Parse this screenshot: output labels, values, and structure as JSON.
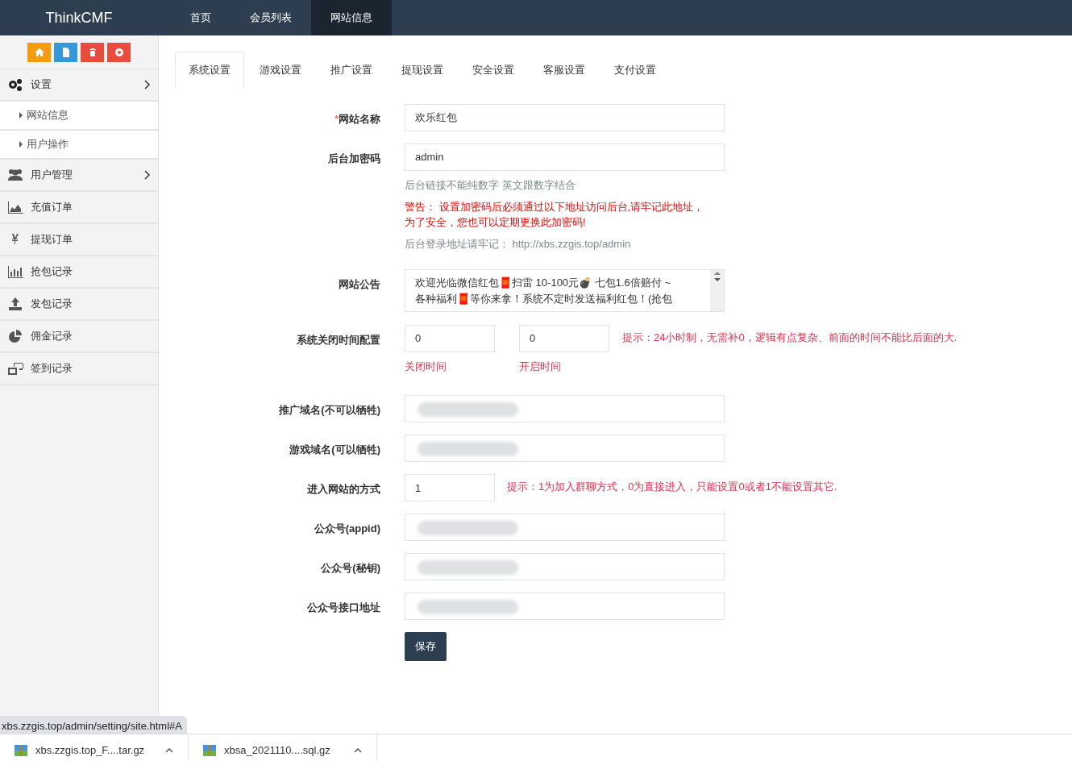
{
  "navbar": {
    "brand": "ThinkCMF",
    "items": [
      {
        "label": "首页",
        "selected": false
      },
      {
        "label": "会员列表",
        "selected": false
      },
      {
        "label": "网站信息",
        "selected": true
      }
    ]
  },
  "sidebar": {
    "toolbar": [
      {
        "color": "#f39c12"
      },
      {
        "color": "#3498db"
      },
      {
        "color": "#e74c3c"
      },
      {
        "color": "#e74c3c"
      }
    ],
    "items": [
      {
        "label": "设置",
        "kind": "group",
        "children": [
          {
            "label": "网站信息"
          },
          {
            "label": "用户操作"
          }
        ]
      },
      {
        "label": "用户管理",
        "kind": "group"
      },
      {
        "label": "充值订单",
        "kind": "link"
      },
      {
        "label": "提现订单",
        "kind": "link"
      },
      {
        "label": "抢包记录",
        "kind": "link"
      },
      {
        "label": "发包记录",
        "kind": "link"
      },
      {
        "label": "佣金记录",
        "kind": "link"
      },
      {
        "label": "签到记录",
        "kind": "link"
      }
    ]
  },
  "tabs": [
    {
      "label": "系统设置",
      "selected": true
    },
    {
      "label": "游戏设置",
      "selected": false
    },
    {
      "label": "推广设置",
      "selected": false
    },
    {
      "label": "提现设置",
      "selected": false
    },
    {
      "label": "安全设置",
      "selected": false
    },
    {
      "label": "客服设置",
      "selected": false
    },
    {
      "label": "支付设置",
      "selected": false
    }
  ],
  "fields": [
    {
      "kind": "text",
      "label": "网站名称",
      "required_mark": "*",
      "value": "欢乐红包"
    },
    {
      "kind": "text",
      "label": "后台加密码",
      "value": "admin",
      "notes": [
        {
          "text": "后台链接不能纯数字 英文跟数字结合",
          "kind": "muted"
        },
        {
          "text": "警告： 设置加密码后必须通过以下地址访问后台,请牢记此地址，为了安全，您也可以定期更换此加密码!",
          "kind": "danger"
        },
        {
          "text": "后台登录地址请牢记：  http://xbs.zzgis.top/admin",
          "kind": "muted"
        }
      ]
    },
    {
      "kind": "textarea",
      "label": "网站公告",
      "lines": [
        "欢迎光临微信红包🧧扫雷  10-100元💣 七包1.6倍赔付 ~",
        "各种福利🧧等你来拿！系统不定时发送福利红包！(抢包"
      ]
    },
    {
      "kind": "pair",
      "label": "系统关闭时间配置",
      "inputs": [
        {
          "value": "0",
          "caption": "关闭时间"
        },
        {
          "value": "0",
          "caption": "开启时间"
        }
      ],
      "hint": "提示：24小时制，无需补0，逻辑有点复杂、前面的时间不能比后面的大."
    },
    {
      "kind": "text",
      "label": "推广域名(不可以牺牲)",
      "redacted": true
    },
    {
      "kind": "text",
      "label": "游戏域名(可以牺牲)",
      "redacted": true
    },
    {
      "kind": "short",
      "label": "进入网站的方式",
      "value": "1",
      "hint": "提示：1为加入群聊方式，0为直接进入，只能设置0或者1不能设置其它."
    },
    {
      "kind": "text",
      "label": "公众号(appid)",
      "redacted": true
    },
    {
      "kind": "text",
      "label": "公众号(秘钥)",
      "redacted": true
    },
    {
      "kind": "text",
      "label": "公众号接口地址",
      "redacted": true
    }
  ],
  "save_button": "保存",
  "status_url": "xbs.zzgis.top/admin/setting/site.html#A",
  "downloads": [
    "xbs.zzgis.top_F....tar.gz",
    "xbsa_2021110....sql.gz"
  ]
}
